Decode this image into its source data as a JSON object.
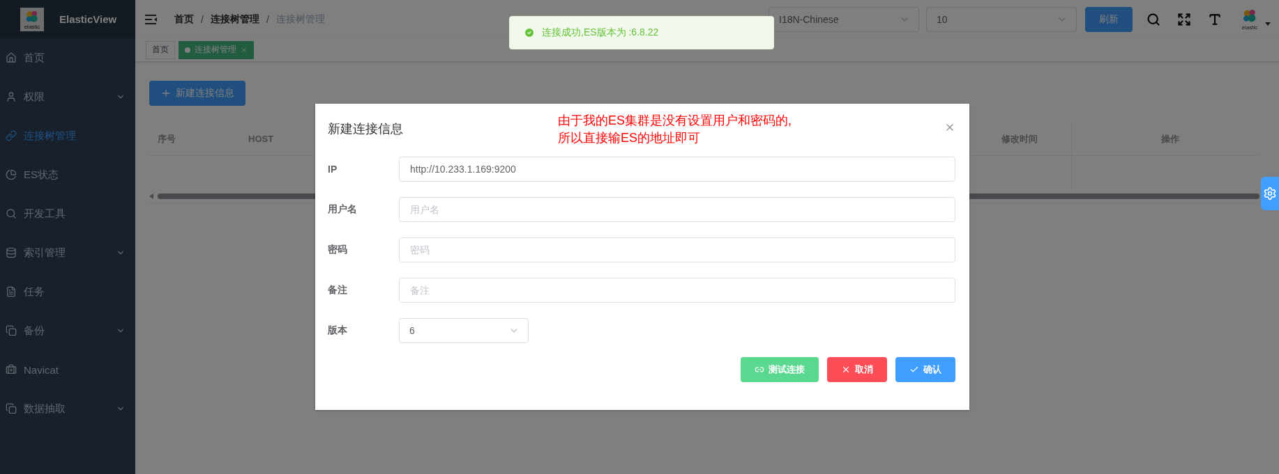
{
  "sidebar": {
    "brand": "ElasticView",
    "logo_caption": "elastic",
    "items": [
      {
        "label": "首页",
        "selected": false,
        "expandable": false
      },
      {
        "label": "权限",
        "selected": false,
        "expandable": true
      },
      {
        "label": "连接树管理",
        "selected": true,
        "expandable": false
      },
      {
        "label": "ES状态",
        "selected": false,
        "expandable": false
      },
      {
        "label": "开发工具",
        "selected": false,
        "expandable": false
      },
      {
        "label": "索引管理",
        "selected": false,
        "expandable": true
      },
      {
        "label": "任务",
        "selected": false,
        "expandable": false
      },
      {
        "label": "备份",
        "selected": false,
        "expandable": true
      },
      {
        "label": "Navicat",
        "selected": false,
        "expandable": false
      },
      {
        "label": "数据抽取",
        "selected": false,
        "expandable": true
      }
    ]
  },
  "topbar": {
    "breadcrumbs": [
      {
        "label": "首页",
        "current": false
      },
      {
        "label": "连接树管理",
        "current": false
      },
      {
        "label": "连接树管理",
        "current": true
      }
    ],
    "breadcrumb_separators": [
      "/",
      "/"
    ],
    "selects": [
      {
        "value": "I18N-Chinese"
      },
      {
        "value": "10"
      }
    ],
    "refresh_button": "刷新",
    "avatar_caption": "elastic"
  },
  "tags": [
    {
      "label": "首页",
      "selected": false
    },
    {
      "label": "连接树管理",
      "selected": true
    }
  ],
  "new_button": "新建连接信息",
  "table": {
    "columns": [
      "序号",
      "HOST",
      "修改时间",
      "操作"
    ]
  },
  "toast": {
    "text": "连接成功,ES版本为 :6.8.22"
  },
  "dialog": {
    "title": "新建连接信息",
    "note_lines": [
      "由于我的ES集群是没有设置用户和密码的,",
      "所以直接输ES的地址即可"
    ],
    "fields": [
      {
        "kind": "input",
        "label": "IP",
        "value": "http://10.233.1.169:9200"
      },
      {
        "kind": "input",
        "label": "用户名",
        "placeholder": "用户名"
      },
      {
        "kind": "input",
        "label": "密码",
        "placeholder": "密码"
      },
      {
        "kind": "input",
        "label": "备注",
        "placeholder": "备注"
      },
      {
        "kind": "select",
        "label": "版本",
        "value": "6"
      }
    ],
    "buttons": [
      {
        "kind": "test",
        "label": "测试连接"
      },
      {
        "kind": "cancel",
        "label": "取消"
      },
      {
        "kind": "confirm",
        "label": "确认"
      }
    ]
  }
}
